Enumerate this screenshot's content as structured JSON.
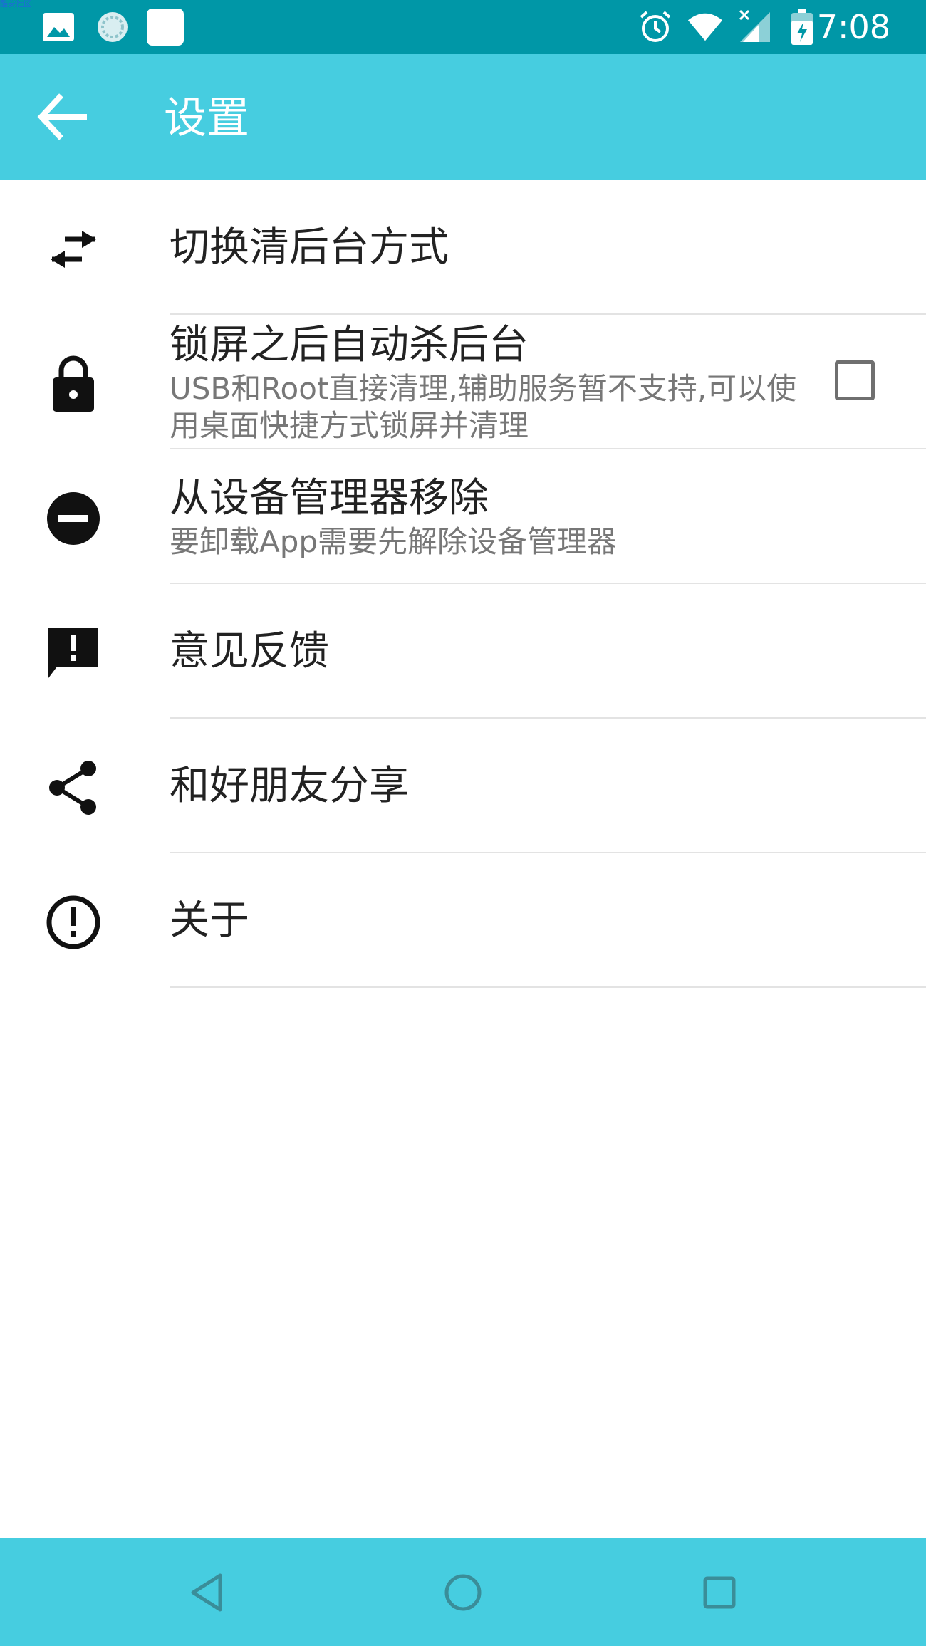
{
  "status_bar": {
    "time": "7:08",
    "watermark": "酷安社区",
    "left_icons": [
      "image-icon",
      "sync-icon",
      "app-icon"
    ],
    "right_icons": [
      "alarm-icon",
      "wifi-icon",
      "signal-icon",
      "battery-charging-icon"
    ]
  },
  "app_bar": {
    "title": "设置",
    "back_icon": "arrow-back-icon"
  },
  "settings": [
    {
      "icon": "swap-horizontal-icon",
      "title": "切换清后台方式",
      "summary": ""
    },
    {
      "icon": "lock-icon",
      "title": "锁屏之后自动杀后台",
      "summary": "USB和Root直接清理,辅助服务暂不支持,可以使用桌面快捷方式锁屏并清理",
      "checked": false
    },
    {
      "icon": "remove-circle-icon",
      "title": "从设备管理器移除",
      "summary": "要卸载App需要先解除设备管理器"
    },
    {
      "icon": "feedback-icon",
      "title": "意见反馈",
      "summary": ""
    },
    {
      "icon": "share-icon",
      "title": "和好朋友分享",
      "summary": ""
    },
    {
      "icon": "info-outline-icon",
      "title": "关于",
      "summary": ""
    }
  ],
  "nav_bar": {
    "icons": [
      "back-triangle-icon",
      "home-circle-icon",
      "recents-square-icon"
    ]
  },
  "colors": {
    "status_bar": "#0097a7",
    "app_bar": "#46cde0",
    "nav_bar": "#46cde0"
  }
}
